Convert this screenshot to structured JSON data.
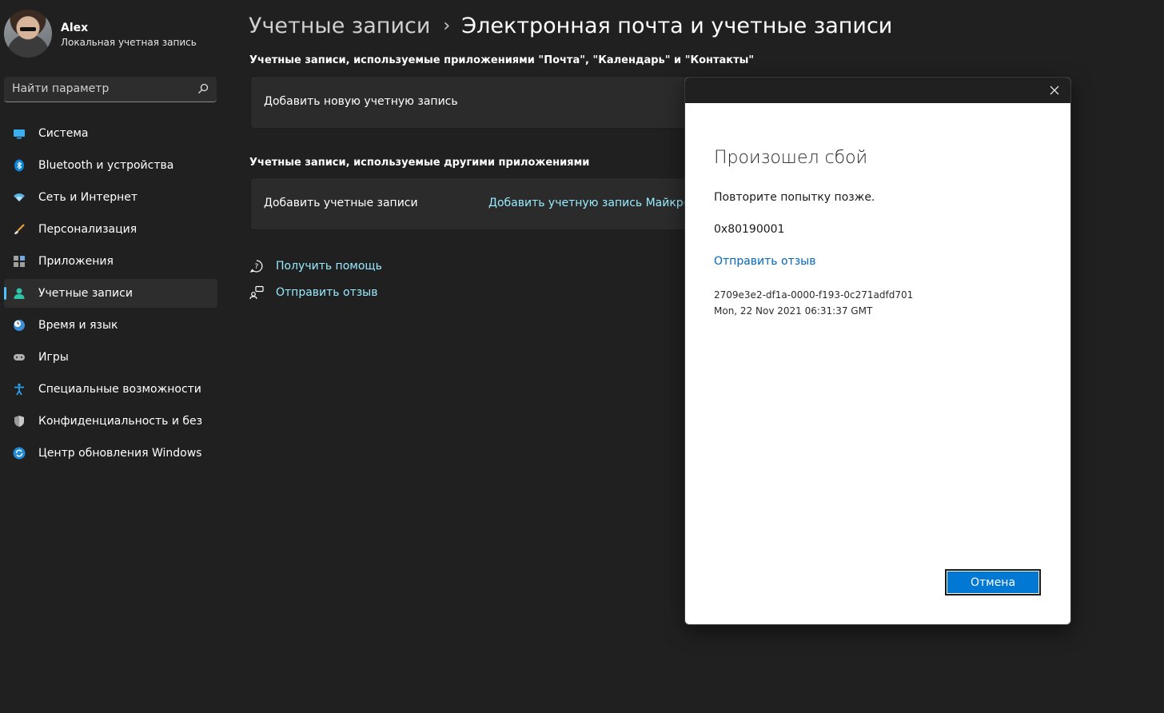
{
  "user": {
    "name": "Alex",
    "account_type": "Локальная учетная запись"
  },
  "search": {
    "placeholder": "Найти параметр"
  },
  "sidebar": {
    "items": [
      {
        "label": "Система",
        "icon": "monitor-icon"
      },
      {
        "label": "Bluetooth и устройства",
        "icon": "bluetooth-icon"
      },
      {
        "label": "Сеть и Интернет",
        "icon": "wifi-icon"
      },
      {
        "label": "Персонализация",
        "icon": "brush-icon"
      },
      {
        "label": "Приложения",
        "icon": "apps-icon"
      },
      {
        "label": "Учетные записи",
        "icon": "person-icon",
        "active": true
      },
      {
        "label": "Время и язык",
        "icon": "clock-globe-icon"
      },
      {
        "label": "Игры",
        "icon": "gamepad-icon"
      },
      {
        "label": "Специальные возможности",
        "icon": "accessibility-icon"
      },
      {
        "label": "Конфиденциальность и безопасность",
        "icon": "shield-icon"
      },
      {
        "label": "Центр обновления Windows",
        "icon": "update-icon"
      }
    ]
  },
  "breadcrumb": {
    "parent": "Учетные записи",
    "separator": "›",
    "current": "Электронная почта и учетные записи"
  },
  "sections": {
    "mail_accounts": {
      "title": "Учетные записи, используемые приложениями \"Почта\", \"Календарь\" и \"Контакты\"",
      "add_label": "Добавить новую учетную запись"
    },
    "other_accounts": {
      "title": "Учетные записи, используемые другими приложениями",
      "add_label": "Добавить учетные записи",
      "add_ms_link": "Добавить учетную запись Майкрософт"
    }
  },
  "help": {
    "get_help": "Получить помощь",
    "send_feedback": "Отправить отзыв"
  },
  "dialog": {
    "title": "Произошел сбой",
    "message": "Повторите попытку позже.",
    "error_code": "0x80190001",
    "feedback_link": "Отправить отзыв",
    "correlation_id": "2709e3e2-df1a-0000-f193-0c271adfd701",
    "timestamp": "Mon, 22 Nov 2021 06:31:37 GMT",
    "cancel_label": "Отмена"
  },
  "colors": {
    "accent": "#4cc2ff",
    "link": "#99ebff",
    "dialog_link": "#0067c0",
    "button": "#0078d4"
  }
}
